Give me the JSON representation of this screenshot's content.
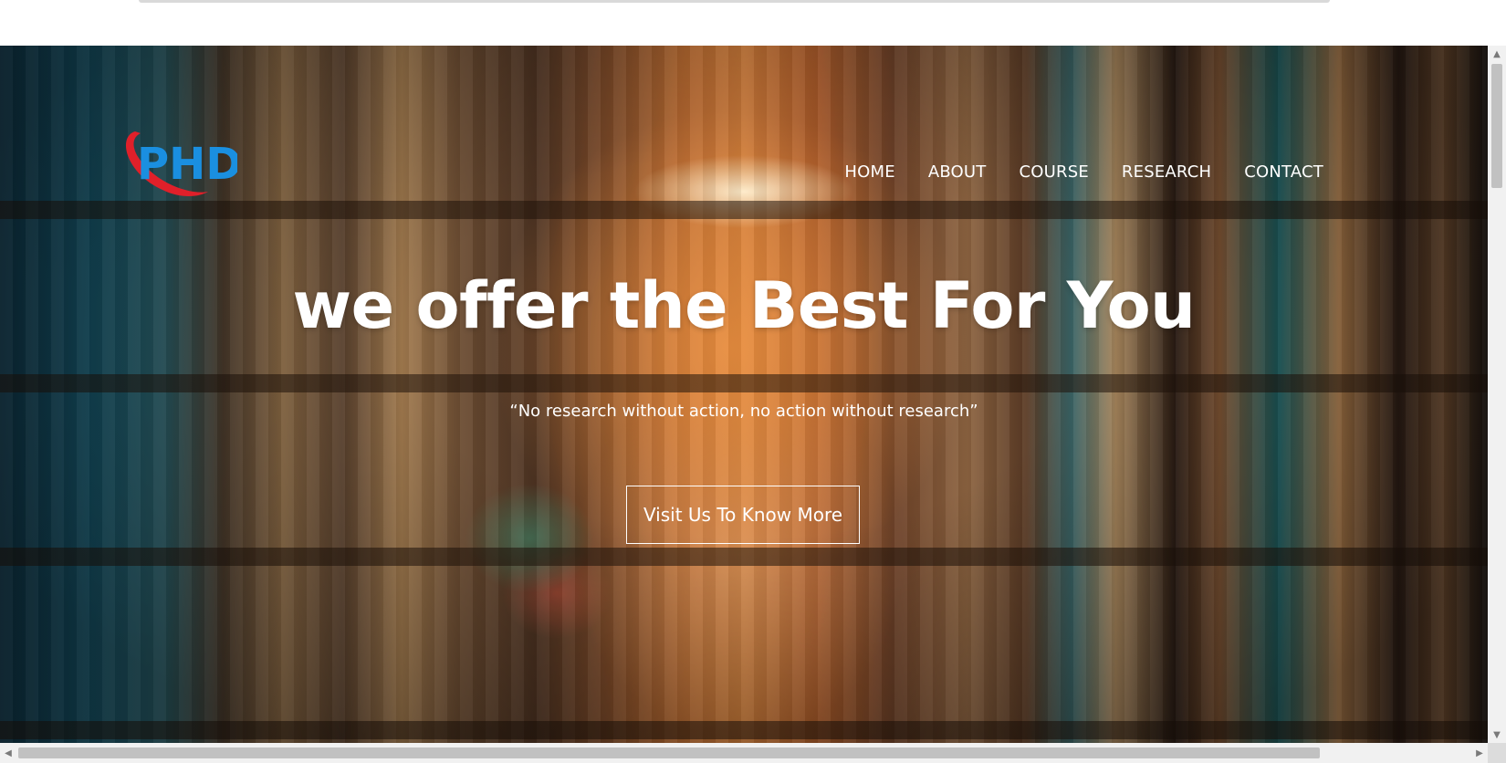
{
  "brand": {
    "logo_text": "PHD",
    "logo_color": "#1a8fe0",
    "swoosh_color": "#e0202a"
  },
  "nav": {
    "items": [
      {
        "label": "HOME"
      },
      {
        "label": "ABOUT"
      },
      {
        "label": "COURSE"
      },
      {
        "label": "RESEARCH"
      },
      {
        "label": "CONTACT"
      }
    ]
  },
  "hero": {
    "title": "we offer the Best For You",
    "subtitle": "“No research without action, no action without research”",
    "cta_label": "Visit Us To Know More"
  },
  "icons": {
    "scroll_up": "scroll-up-icon",
    "scroll_down": "scroll-down-icon",
    "scroll_left": "scroll-left-icon",
    "scroll_right": "scroll-right-icon"
  }
}
